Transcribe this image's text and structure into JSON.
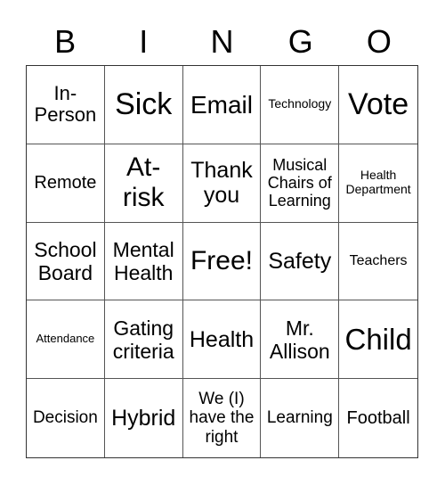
{
  "header": {
    "letters": [
      "B",
      "I",
      "N",
      "G",
      "O"
    ]
  },
  "grid": {
    "rows": [
      [
        "In-Person",
        "Sick",
        "Email",
        "Technology",
        "Vote"
      ],
      [
        "Remote",
        "At-risk",
        "Thank you",
        "Musical Chairs of Learning",
        "Health Department"
      ],
      [
        "School Board",
        "Mental Health",
        "Free!",
        "Safety",
        "Teachers"
      ],
      [
        "Attendance",
        "Gating criteria",
        "Health",
        "Mr. Allison",
        "Child"
      ],
      [
        "Decision",
        "Hybrid",
        "We (I) have the right",
        "Learning",
        "Football"
      ]
    ]
  }
}
